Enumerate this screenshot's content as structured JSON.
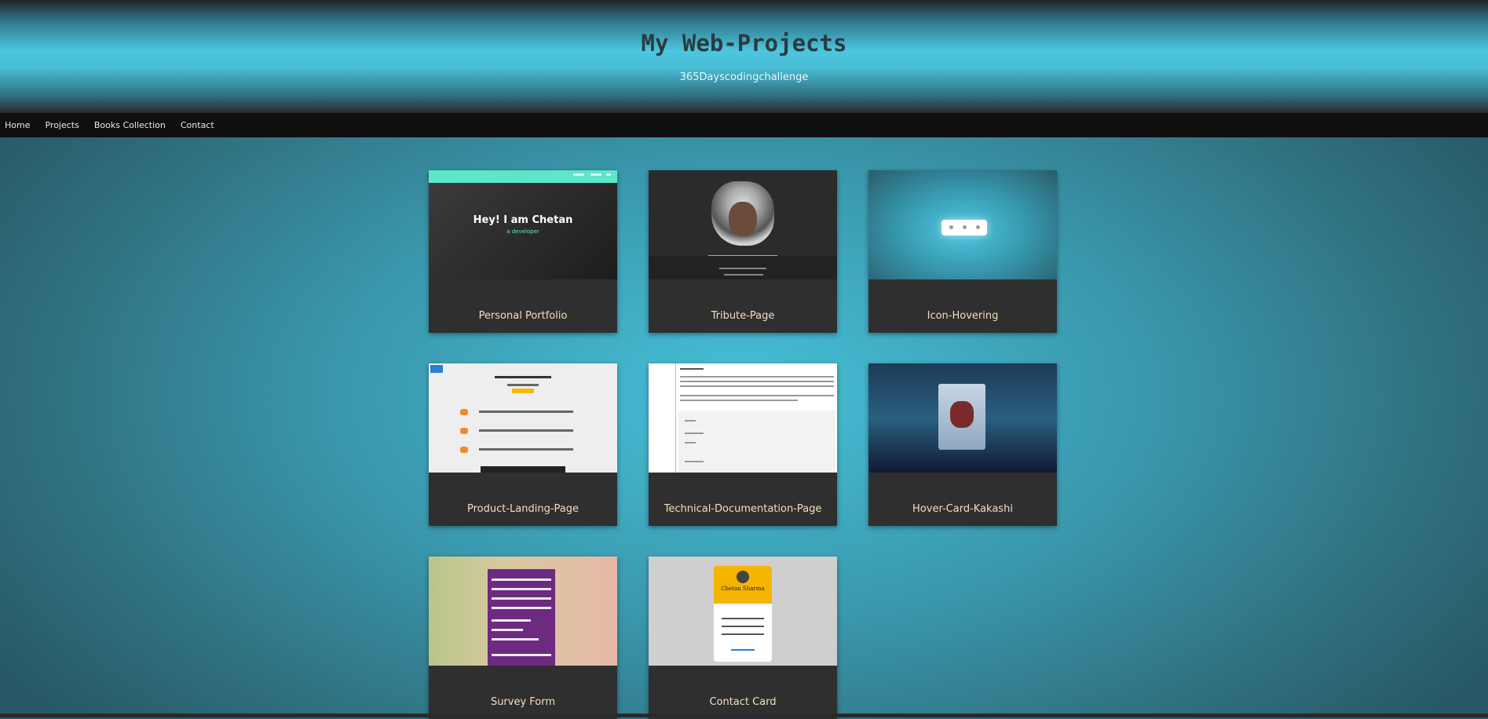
{
  "header": {
    "title": "My Web-Projects",
    "subtitle": "365Dayscodingchallenge"
  },
  "nav": {
    "items": [
      "Home",
      "Projects",
      "Books Collection",
      "Contact"
    ]
  },
  "cards": [
    {
      "label": "Personal Portfolio",
      "thumb_heading": "Hey! I am Chetan",
      "thumb_sub": "a developer"
    },
    {
      "label": "Tribute-Page"
    },
    {
      "label": "Icon-Hovering"
    },
    {
      "label": "Product-Landing-Page"
    },
    {
      "label": "Technical-Documentation-Page"
    },
    {
      "label": "Hover-Card-Kakashi"
    },
    {
      "label": "Survey Form"
    },
    {
      "label": "Contact Card",
      "thumb_name": "Chetan Sharma"
    }
  ],
  "colors": {
    "nav_bg": "#0f0f0f",
    "card_bg": "#2f2f2f",
    "card_label": "#f2dec0",
    "accent_teal": "#5de6c8"
  }
}
